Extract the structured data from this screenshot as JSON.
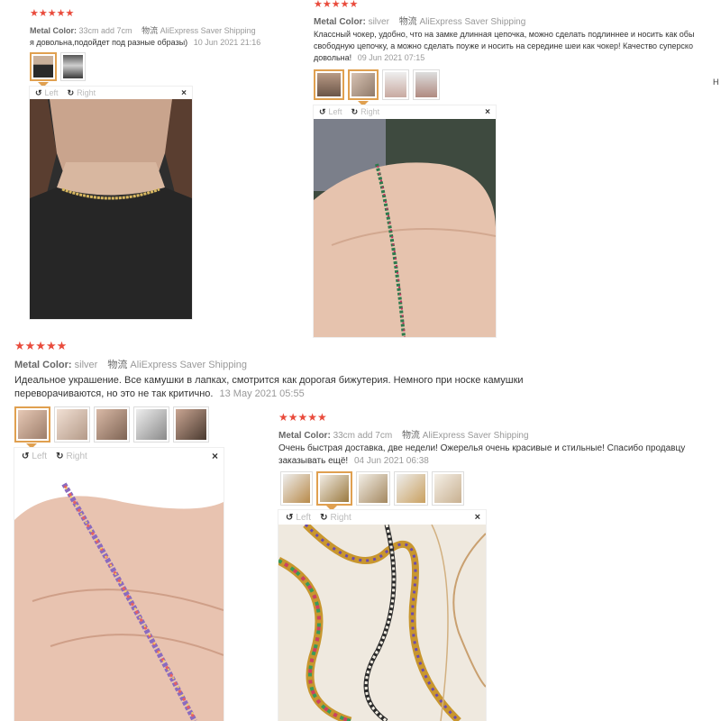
{
  "reviews": [
    {
      "stars": "★★★★★",
      "metal_label": "Metal Color:",
      "metal_value": "33cm add 7cm",
      "shipping_label": "物流",
      "shipping_value": "AliExpress Saver Shipping",
      "text": "я довольна,подойдет под разные образы)",
      "date": "10 Jun 2021 21:16",
      "viewer": {
        "left": "Left",
        "right": "Right",
        "close": "×"
      }
    },
    {
      "stars": "★★★★★",
      "metal_label": "Metal Color:",
      "metal_value": "silver",
      "shipping_label": "物流",
      "shipping_value": "AliExpress Saver Shipping",
      "text": "Классный чокер, удобно, что на замке длинная цепочка, можно сделать подлиннее и носить как обы свободную цепочку, а можно сделать поуже и носить на середине шеи как чокер! Качество суперско довольна!",
      "date": "09 Jun 2021 07:15",
      "side_char": "Н",
      "viewer": {
        "left": "Left",
        "right": "Right",
        "close": "×"
      }
    },
    {
      "stars": "★★★★★",
      "metal_label": "Metal Color:",
      "metal_value": "silver",
      "shipping_label": "物流",
      "shipping_value": "AliExpress Saver Shipping",
      "text": "Идеальное украшение. Все камушки в лапках, смотрится как дорогая бижутерия. Немного при носке камушки переворачиваются, но это не так критично.",
      "date": "13 May 2021 05:55",
      "viewer": {
        "left": "Left",
        "right": "Right",
        "close": "×"
      }
    },
    {
      "stars": "★★★★★",
      "metal_label": "Metal Color:",
      "metal_value": "33cm add 7cm",
      "shipping_label": "物流",
      "shipping_value": "AliExpress Saver Shipping",
      "text": "Очень быстрая доставка, две недели! Ожерелья очень красивые и стильные! Спасибо продавцу заказывать ещё!",
      "date": "04 Jun 2021 06:38",
      "viewer": {
        "left": "Left",
        "right": "Right",
        "close": "×"
      }
    }
  ],
  "colors": {
    "star": "#e94b3c",
    "active_thumb_border": "#e0a050",
    "muted": "#999999"
  },
  "icons": [
    "rotate-left-icon",
    "rotate-right-icon",
    "close-icon"
  ]
}
